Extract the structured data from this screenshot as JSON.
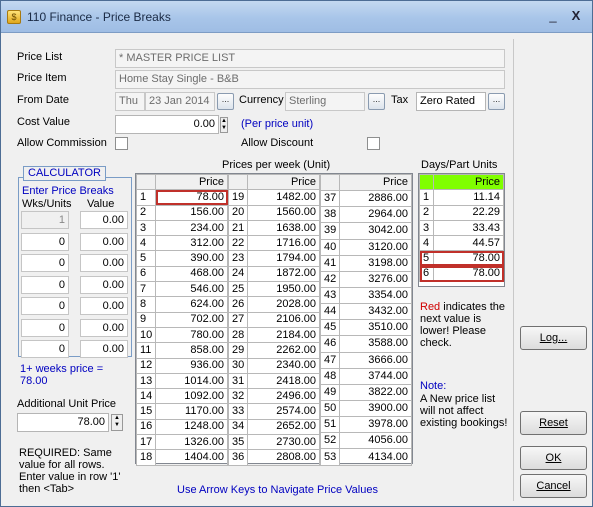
{
  "window": {
    "title": "110 Finance - Price Breaks",
    "min": "_",
    "close": "X"
  },
  "form": {
    "price_list_label": "Price List",
    "price_list_value": "* MASTER PRICE LIST",
    "price_item_label": "Price Item",
    "price_item_value": "Home Stay Single - B&B",
    "from_date_label": "From Date",
    "from_date_day": "Thu",
    "from_date_value": "23 Jan 2014",
    "currency_label": "Currency",
    "currency_value": "Sterling",
    "tax_label": "Tax",
    "tax_value": "Zero Rated",
    "cost_value_label": "Cost Value",
    "cost_value": "0.00",
    "per_price_unit": "(Per price unit)",
    "allow_commission_label": "Allow Commission",
    "allow_discount_label": "Allow Discount",
    "dots": "..."
  },
  "calculator": {
    "title": "CALCULATOR",
    "enter_price_breaks": "Enter Price Breaks",
    "col_wks": "Wks/Units",
    "col_value": "Value",
    "rows": [
      {
        "wks": "1",
        "value": "0.00"
      },
      {
        "wks": "0",
        "value": "0.00"
      },
      {
        "wks": "0",
        "value": "0.00"
      },
      {
        "wks": "0",
        "value": "0.00"
      },
      {
        "wks": "0",
        "value": "0.00"
      },
      {
        "wks": "0",
        "value": "0.00"
      },
      {
        "wks": "0",
        "value": "0.00"
      }
    ],
    "summary": "1+ weeks price = 78.00",
    "additional_label": "Additional Unit Price",
    "additional_value": "78.00",
    "required_text": "REQUIRED: Same value for all rows. Enter value in row '1' then <Tab>"
  },
  "weekly": {
    "heading": "Prices per week (Unit)",
    "price_header": "Price",
    "footer": "Use Arrow Keys to Navigate Price Values",
    "col1": [
      [
        "1",
        "78.00"
      ],
      [
        "2",
        "156.00"
      ],
      [
        "3",
        "234.00"
      ],
      [
        "4",
        "312.00"
      ],
      [
        "5",
        "390.00"
      ],
      [
        "6",
        "468.00"
      ],
      [
        "7",
        "546.00"
      ],
      [
        "8",
        "624.00"
      ],
      [
        "9",
        "702.00"
      ],
      [
        "10",
        "780.00"
      ],
      [
        "11",
        "858.00"
      ],
      [
        "12",
        "936.00"
      ],
      [
        "13",
        "1014.00"
      ],
      [
        "14",
        "1092.00"
      ],
      [
        "15",
        "1170.00"
      ],
      [
        "16",
        "1248.00"
      ],
      [
        "17",
        "1326.00"
      ],
      [
        "18",
        "1404.00"
      ]
    ],
    "col2": [
      [
        "19",
        "1482.00"
      ],
      [
        "20",
        "1560.00"
      ],
      [
        "21",
        "1638.00"
      ],
      [
        "22",
        "1716.00"
      ],
      [
        "23",
        "1794.00"
      ],
      [
        "24",
        "1872.00"
      ],
      [
        "25",
        "1950.00"
      ],
      [
        "26",
        "2028.00"
      ],
      [
        "27",
        "2106.00"
      ],
      [
        "28",
        "2184.00"
      ],
      [
        "29",
        "2262.00"
      ],
      [
        "30",
        "2340.00"
      ],
      [
        "31",
        "2418.00"
      ],
      [
        "32",
        "2496.00"
      ],
      [
        "33",
        "2574.00"
      ],
      [
        "34",
        "2652.00"
      ],
      [
        "35",
        "2730.00"
      ],
      [
        "36",
        "2808.00"
      ]
    ],
    "col3": [
      [
        "37",
        "2886.00"
      ],
      [
        "38",
        "2964.00"
      ],
      [
        "39",
        "3042.00"
      ],
      [
        "40",
        "3120.00"
      ],
      [
        "41",
        "3198.00"
      ],
      [
        "42",
        "3276.00"
      ],
      [
        "43",
        "3354.00"
      ],
      [
        "44",
        "3432.00"
      ],
      [
        "45",
        "3510.00"
      ],
      [
        "46",
        "3588.00"
      ],
      [
        "47",
        "3666.00"
      ],
      [
        "48",
        "3744.00"
      ],
      [
        "49",
        "3822.00"
      ],
      [
        "50",
        "3900.00"
      ],
      [
        "51",
        "3978.00"
      ],
      [
        "52",
        "4056.00"
      ],
      [
        "53",
        "4134.00"
      ]
    ]
  },
  "days": {
    "heading": "Days/Part Units",
    "price_header": "Price",
    "rows": [
      [
        "1",
        "11.14"
      ],
      [
        "2",
        "22.29"
      ],
      [
        "3",
        "33.43"
      ],
      [
        "4",
        "44.57"
      ],
      [
        "5",
        "78.00"
      ],
      [
        "6",
        "78.00"
      ]
    ],
    "red_word": "Red",
    "red_note": " indicates the next value is lower!  Please check.",
    "note_title": "Note:",
    "note_text": "A New price list will not affect existing bookings!"
  },
  "buttons": {
    "log": "Log...",
    "reset": "Reset",
    "ok": "OK",
    "cancel": "Cancel"
  },
  "colors": {
    "header_green": "#80ff00",
    "highlight_red": "#c0302a",
    "label_blue": "#0000c0"
  }
}
